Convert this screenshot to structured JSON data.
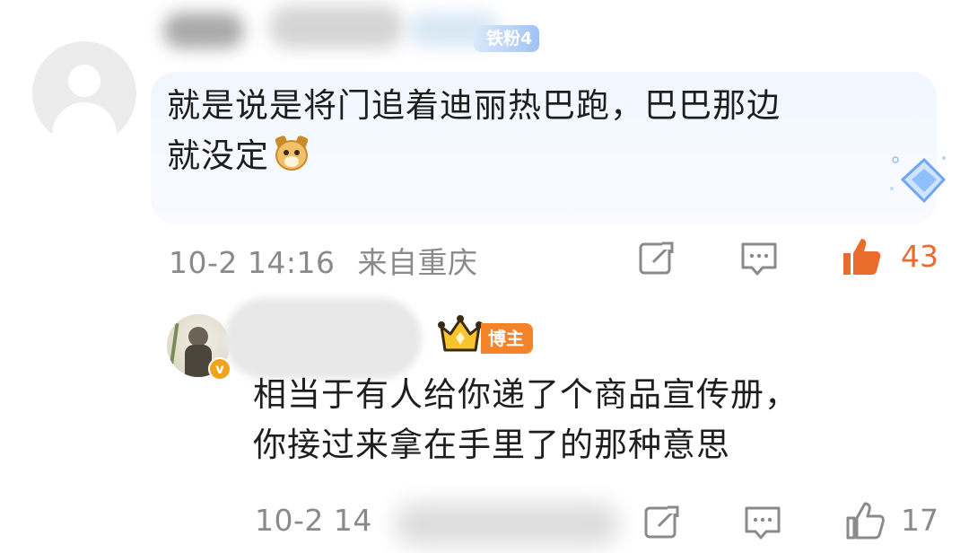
{
  "comment1": {
    "fan_badge": "铁粉4",
    "text_lines": [
      "就是说是将门追着迪丽热巴跑，巴巴那边",
      "就没定"
    ],
    "emoji": "doge-emoji",
    "time": "10-2 14:16",
    "location": "来自重庆",
    "like_count": "43",
    "like_color": "#ea6c2d"
  },
  "reply": {
    "author_badge": "博主",
    "text_lines": [
      "相当于有人给你递了个商品宣传册，",
      "你接过来拿在手里了的那种意思"
    ],
    "time": "10-2 14",
    "like_count": "17"
  },
  "icons": {
    "share": "share-icon",
    "comment": "comment-icon",
    "like": "thumbs-up-icon",
    "verified": "verified-v-icon",
    "crown": "crown-icon",
    "diamond": "diamond-icon"
  },
  "colors": {
    "like_active": "#ea6c2d",
    "meta": "#8a8a8a",
    "blogger_badge": "#f5832a",
    "fan_badge": "#9fc3f3",
    "bubble": "#f1f6ff"
  }
}
